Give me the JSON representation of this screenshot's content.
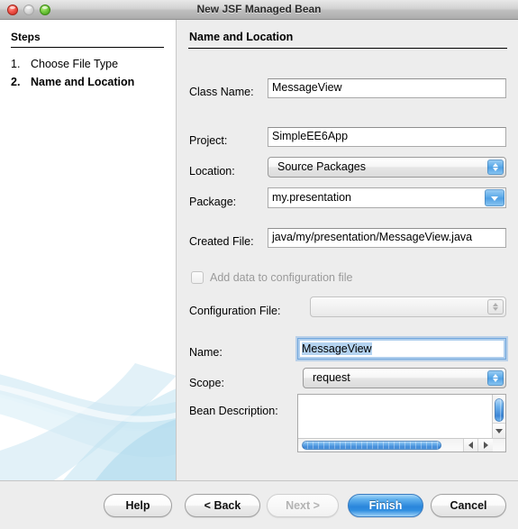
{
  "window": {
    "title": "New JSF Managed Bean",
    "traffic_lights": [
      "close-button",
      "minimize-button",
      "zoom-button"
    ]
  },
  "steps": {
    "heading": "Steps",
    "items": [
      {
        "number": "1.",
        "label": "Choose File Type",
        "current": false
      },
      {
        "number": "2.",
        "label": "Name and Location",
        "current": true
      }
    ]
  },
  "pane": {
    "heading": "Name and Location",
    "fields": {
      "class_name": {
        "label": "Class Name:",
        "value": "MessageView"
      },
      "project": {
        "label": "Project:",
        "value": "SimpleEE6App"
      },
      "location": {
        "label": "Location:",
        "value": "Source Packages"
      },
      "package": {
        "label": "Package:",
        "value": "my.presentation"
      },
      "created_file": {
        "label": "Created File:",
        "value": "java/my/presentation/MessageView.java"
      },
      "add_data_checkbox": {
        "label": "Add data to configuration file",
        "checked": false,
        "enabled": false
      },
      "configuration_file": {
        "label": "Configuration File:",
        "value": "",
        "enabled": false
      },
      "name": {
        "label": "Name:",
        "value": "MessageView",
        "focused": true,
        "selected": true
      },
      "scope": {
        "label": "Scope:",
        "value": "request"
      },
      "bean_description": {
        "label": "Bean Description:",
        "value": ""
      }
    }
  },
  "buttons": {
    "help": "Help",
    "back": "< Back",
    "next": "Next >",
    "finish": "Finish",
    "cancel": "Cancel"
  },
  "colors": {
    "accent_blue": "#2a86db",
    "pane_background": "#ededed",
    "panel_background": "#ffffff",
    "selection_blue": "#b4d3f0",
    "disabled_text": "#a8a8a8"
  }
}
